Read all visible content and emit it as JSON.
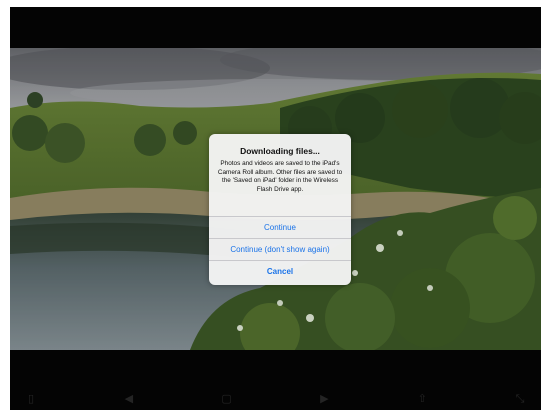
{
  "alert": {
    "title": "Downloading files...",
    "message": "Photos and videos are saved to the iPad's Camera Roll album.  Other files are saved to the 'Saved on iPad' folder in the Wireless Flash Drive app.",
    "buttons": {
      "continue": "Continue",
      "continue_dont_show": "Continue (don't show again)",
      "cancel": "Cancel"
    },
    "button_color": "#1a73e8"
  },
  "toolbar": {
    "icons": [
      "document-icon",
      "back-arrow-icon",
      "mouse-icon",
      "forward-arrow-icon",
      "share-icon",
      "expand-icon"
    ]
  },
  "photo": {
    "subject": "lake-landscape-with-hills"
  }
}
